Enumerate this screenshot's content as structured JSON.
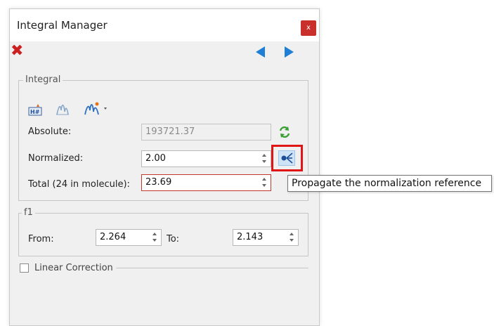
{
  "window": {
    "title": "Integral Manager",
    "close_label": "x"
  },
  "toolbar": {
    "delete_icon": "red-x-icon",
    "prev_icon": "arrow-left-icon",
    "next_icon": "arrow-right-icon"
  },
  "integral": {
    "group_label": "Integral",
    "tools": [
      "h-label-icon",
      "integral-icon",
      "integral-dropdown-icon"
    ],
    "absolute_label": "Absolute:",
    "absolute_value": "193721.37",
    "normalized_label": "Normalized:",
    "normalized_value": "2.00",
    "total_label": "Total (24 in molecule):",
    "total_value": "23.69"
  },
  "propagate": {
    "tooltip": "Propagate the normalization reference"
  },
  "f1": {
    "group_label": "f1",
    "from_label": "From:",
    "from_value": "2.264",
    "to_label": "To:",
    "to_value": "2.143"
  },
  "linear_correction": {
    "label": "Linear Correction",
    "checked": false
  },
  "colors": {
    "accent": "#1f7fd6",
    "delete": "#cc1f1f",
    "highlight": "#e01515"
  }
}
